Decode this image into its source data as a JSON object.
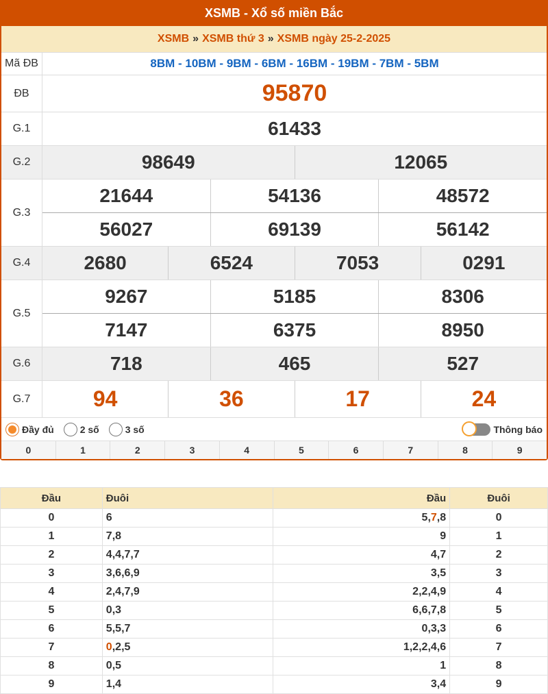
{
  "header": {
    "title": "XSMB - Xổ số miền Bắc"
  },
  "breadcrumb": {
    "items": [
      "XSMB",
      "XSMB thứ 3",
      "XSMB ngày 25-2-2025"
    ],
    "sep": "»"
  },
  "results": {
    "madb_label": "Mã ĐB",
    "madb_value": "8BM - 10BM - 9BM - 6BM - 16BM - 19BM - 7BM - 5BM",
    "db_label": "ĐB",
    "db": "95870",
    "g1_label": "G.1",
    "g1": [
      "61433"
    ],
    "g2_label": "G.2",
    "g2": [
      "98649",
      "12065"
    ],
    "g3_label": "G.3",
    "g3": [
      "21644",
      "54136",
      "48572",
      "56027",
      "69139",
      "56142"
    ],
    "g4_label": "G.4",
    "g4": [
      "2680",
      "6524",
      "7053",
      "0291"
    ],
    "g5_label": "G.5",
    "g5": [
      "9267",
      "5185",
      "8306",
      "7147",
      "6375",
      "8950"
    ],
    "g6_label": "G.6",
    "g6": [
      "718",
      "465",
      "527"
    ],
    "g7_label": "G.7",
    "g7": [
      "94",
      "36",
      "17",
      "24"
    ]
  },
  "options": {
    "full": "Đầy đủ",
    "two": "2 số",
    "three": "3 số",
    "selected": "full",
    "notify": "Thông báo"
  },
  "digits": [
    "0",
    "1",
    "2",
    "3",
    "4",
    "5",
    "6",
    "7",
    "8",
    "9"
  ],
  "loto": {
    "headers": [
      "Đầu",
      "Đuôi",
      "Đầu",
      "Đuôi"
    ],
    "rows": [
      {
        "d": "0",
        "tail": "6",
        "head": "5,7,8",
        "head_hl": 1
      },
      {
        "d": "1",
        "tail": "7,8",
        "head": "9"
      },
      {
        "d": "2",
        "tail": "4,4,7,7",
        "head": "4,7"
      },
      {
        "d": "3",
        "tail": "3,6,6,9",
        "head": "3,5"
      },
      {
        "d": "4",
        "tail": "2,4,7,9",
        "head": "2,2,4,9"
      },
      {
        "d": "5",
        "tail": "0,3",
        "head": "6,6,7,8"
      },
      {
        "d": "6",
        "tail": "5,5,7",
        "head": "0,3,3"
      },
      {
        "d": "7",
        "tail": "0,2,5",
        "head": "1,2,2,4,6",
        "tail_hl": 0
      },
      {
        "d": "8",
        "tail": "0,5",
        "head": "1"
      },
      {
        "d": "9",
        "tail": "1,4",
        "head": "3,4"
      }
    ]
  },
  "colors": {
    "accent": "#d04f00",
    "highlight_bg": "#f8e9c0",
    "link_blue": "#1565c0"
  }
}
